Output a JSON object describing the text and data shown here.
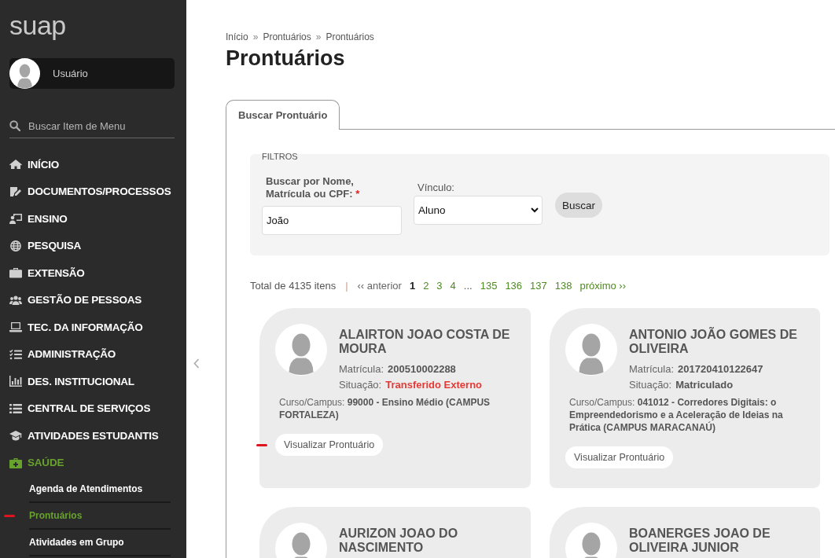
{
  "sidebar": {
    "logo": "suap",
    "user": {
      "name": "Usuário"
    },
    "search": {
      "placeholder": "Buscar Item de Menu"
    },
    "menu": [
      {
        "label": "INÍCIO",
        "selected": false
      },
      {
        "label": "DOCUMENTOS/PROCESSOS",
        "selected": false
      },
      {
        "label": "ENSINO",
        "selected": false
      },
      {
        "label": "PESQUISA",
        "selected": false
      },
      {
        "label": "EXTENSÃO",
        "selected": false
      },
      {
        "label": "GESTÃO DE PESSOAS",
        "selected": false
      },
      {
        "label": "TEC. DA INFORMAÇÃO",
        "selected": false
      },
      {
        "label": "ADMINISTRAÇÃO",
        "selected": false
      },
      {
        "label": "DES. INSTITUCIONAL",
        "selected": false
      },
      {
        "label": "CENTRAL DE SERVIÇOS",
        "selected": false
      },
      {
        "label": "ATIVIDADES ESTUDANTIS",
        "selected": false
      },
      {
        "label": "SAÚDE",
        "selected": true,
        "children": [
          {
            "label": "Agenda de Atendimentos",
            "selected": false,
            "marked": false
          },
          {
            "label": "Prontuários",
            "selected": true,
            "marked": true
          },
          {
            "label": "Atividades em Grupo",
            "selected": false,
            "marked": false
          }
        ]
      }
    ]
  },
  "breadcrumb": [
    {
      "kind": "link",
      "text": "Início"
    },
    {
      "kind": "separator",
      "text": "»"
    },
    {
      "kind": "link",
      "text": "Prontuários"
    },
    {
      "kind": "separator",
      "text": "»"
    },
    {
      "kind": "current",
      "text": "Prontuários"
    }
  ],
  "page_title": "Prontuários",
  "tabs": [
    {
      "label": "Buscar Prontuário",
      "selected": true
    }
  ],
  "filters": {
    "legend": "FILTROS",
    "fields": [
      {
        "kind": "text",
        "label": "Buscar por Nome, Matrícula ou CPF:",
        "required_mark": "*",
        "value": "João"
      },
      {
        "kind": "select",
        "label": "Vínculo:",
        "value": "Aluno"
      }
    ],
    "button": "Buscar"
  },
  "pagination": {
    "total": "Total de 4135 itens",
    "divider": "|",
    "previous": {
      "label": "‹‹ anterior",
      "disabled": true
    },
    "pages": [
      {
        "kind": "page",
        "label": "1",
        "selected": true
      },
      {
        "kind": "page",
        "label": "2",
        "selected": false
      },
      {
        "kind": "page",
        "label": "3",
        "selected": false
      },
      {
        "kind": "page",
        "label": "4",
        "selected": false
      },
      {
        "kind": "gap",
        "label": "...",
        "selected": false
      },
      {
        "kind": "page",
        "label": "135",
        "selected": false
      },
      {
        "kind": "page",
        "label": "136",
        "selected": false
      },
      {
        "kind": "page",
        "label": "137",
        "selected": false
      },
      {
        "kind": "page",
        "label": "138",
        "selected": false
      }
    ],
    "next": {
      "label": "próximo ››",
      "disabled": false
    }
  },
  "cards": [
    {
      "name": "ALAIRTON JOAO COSTA DE MOURA",
      "fields": [
        {
          "label": "Matrícula:",
          "value": "200510002288"
        },
        {
          "label": "Situação:",
          "value": "Transferido Externo",
          "color": "#e53935"
        }
      ],
      "course": "Curso/Campus: **99000 - Ensino Médio (CAMPUS FORTALEZA)**",
      "button": {
        "label": "Visualizar Prontuário",
        "marked": true
      }
    },
    {
      "name": "ANTONIO JOÃO GOMES DE OLIVEIRA",
      "fields": [
        {
          "label": "Matrícula:",
          "value": "201720410122647"
        },
        {
          "label": "Situação:",
          "value": "Matriculado",
          "color": "#555555"
        }
      ],
      "course": "Curso/Campus: **041012 - Corredores Digitais: o Empreendedorismo e a Aceleração de Ideias na Prática (CAMPUS MARACANAÚ)**",
      "button": {
        "label": "Visualizar Prontuário",
        "marked": false
      }
    },
    {
      "name": "AURIZON JOAO DO NASCIMENTO"
    },
    {
      "name": "BOANERGES JOAO DE OLIVEIRA JUNIOR"
    }
  ]
}
